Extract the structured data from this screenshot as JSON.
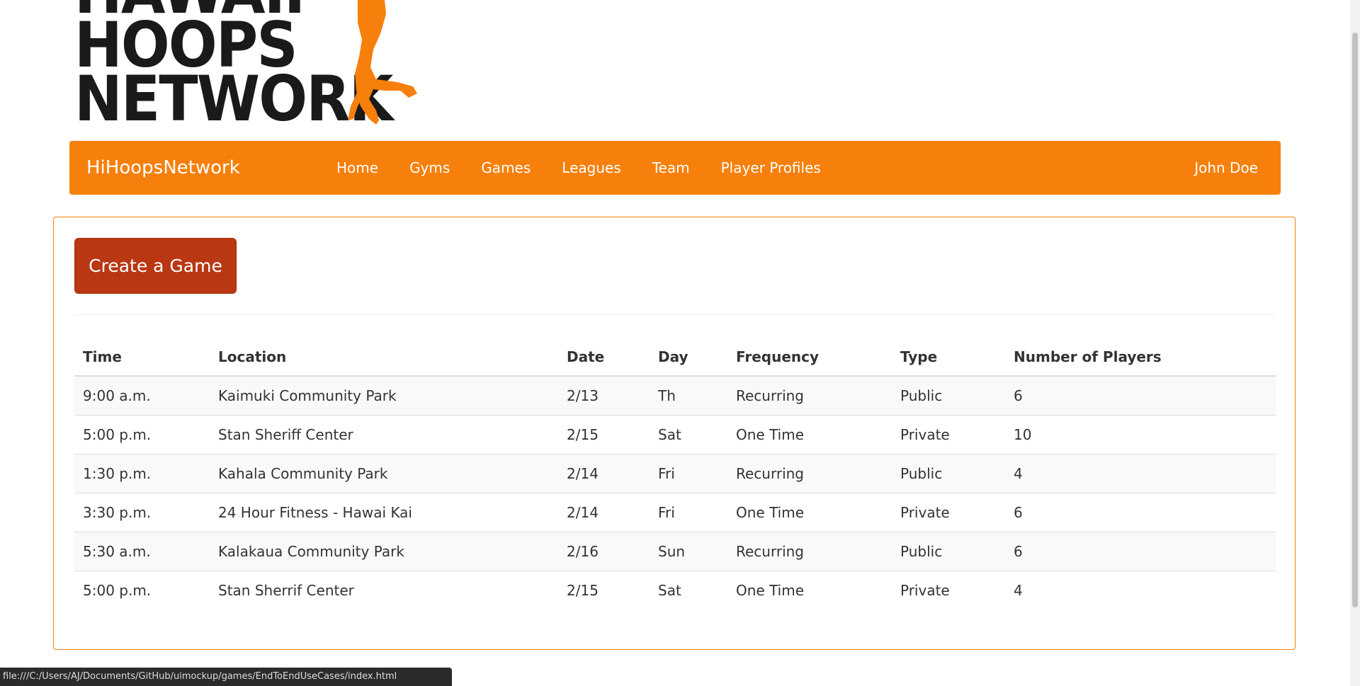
{
  "logo": {
    "lines": [
      "HAWAII",
      "HOOPS",
      "NETWORK"
    ],
    "icon": "basketball-player-logo-icon"
  },
  "navbar": {
    "brand": "HiHoopsNetwork",
    "links": [
      "Home",
      "Gyms",
      "Games",
      "Leagues",
      "Team",
      "Player Profiles"
    ],
    "user": "John Doe"
  },
  "main": {
    "create_button": "Create a Game",
    "table": {
      "headers": [
        "Time",
        "Location",
        "Date",
        "Day",
        "Frequency",
        "Type",
        "Number of Players"
      ],
      "rows": [
        [
          "9:00 a.m.",
          "Kaimuki Community Park",
          "2/13",
          "Th",
          "Recurring",
          "Public",
          "6"
        ],
        [
          "5:00 p.m.",
          "Stan Sheriff Center",
          "2/15",
          "Sat",
          "One Time",
          "Private",
          "10"
        ],
        [
          "1:30 p.m.",
          "Kahala Community Park",
          "2/14",
          "Fri",
          "Recurring",
          "Public",
          "4"
        ],
        [
          "3:30 p.m.",
          "24 Hour Fitness - Hawai Kai",
          "2/14",
          "Fri",
          "One Time",
          "Private",
          "6"
        ],
        [
          "5:30 a.m.",
          "Kalakaua Community Park",
          "2/16",
          "Sun",
          "Recurring",
          "Public",
          "6"
        ],
        [
          "5:00 p.m.",
          "Stan Sherrif Center",
          "2/15",
          "Sat",
          "One Time",
          "Private",
          "4"
        ]
      ]
    }
  },
  "status_bar": {
    "url": "file:///C:/Users/AJ/Documents/GitHub/uimockup/games/EndToEndUseCases/index.html"
  },
  "colors": {
    "brand_orange": "#f6800b",
    "button_red": "#b93712"
  }
}
